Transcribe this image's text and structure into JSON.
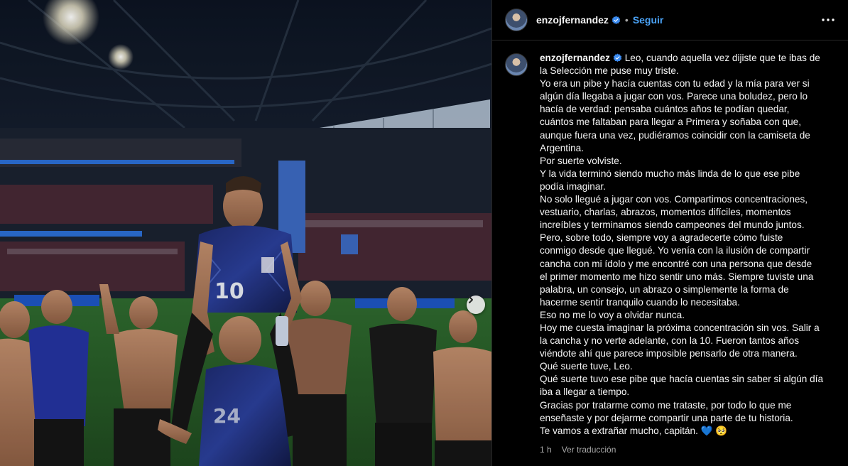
{
  "post": {
    "username": "enzojfernandez",
    "follow_label": "Seguir",
    "separator": "•",
    "time_ago": "1 h",
    "translate_label": "Ver traducción"
  },
  "photo": {
    "jersey_number": "10",
    "jersey_number_2": "24"
  },
  "caption_lines": [
    "Leo, cuando aquella vez dijiste que te ibas de",
    "la Selección me puse muy triste.",
    "Yo era un pibe y hacía cuentas con tu edad y la mía para ver si",
    "algún día llegaba a jugar con vos. Parece una boludez, pero lo",
    "hacía de verdad: pensaba cuántos años te podían quedar,",
    "cuántos me faltaban para llegar a Primera y soñaba con que,",
    "aunque fuera una vez, pudiéramos coincidir con la camiseta de",
    "Argentina.",
    "Por suerte volviste.",
    "Y la vida terminó siendo mucho más linda de lo que ese pibe",
    "podía imaginar.",
    "No solo llegué a jugar con vos. Compartimos concentraciones,",
    "vestuario, charlas, abrazos, momentos difíciles, momentos",
    "increíbles y terminamos siendo campeones del mundo juntos.",
    "Pero, sobre todo, siempre voy a agradecerte cómo fuiste",
    "conmigo desde que llegué. Yo venía con la ilusión de compartir",
    "cancha con mi ídolo y me encontré con una persona que desde",
    "el primer momento me hizo sentir uno más. Siempre tuviste una",
    "palabra, un consejo, un abrazo o simplemente la forma de",
    "hacerme sentir tranquilo cuando lo necesitaba.",
    "Eso no me lo voy a olvidar nunca.",
    "Hoy me cuesta imaginar la próxima concentración sin vos. Salir a",
    "la cancha y no verte adelante, con la 10. Fueron tantos años",
    "viéndote ahí que parece imposible pensarlo de otra manera.",
    "Qué suerte tuve, Leo.",
    "Qué suerte tuvo ese pibe que hacía cuentas sin saber si algún día",
    "iba a llegar a tiempo.",
    "Gracias por tratarme como me trataste, por todo lo que me",
    "enseñaste y por dejarme compartir una parte de tu historia.",
    "Te vamos a extrañar mucho, capitán. 💙 🥺"
  ],
  "colors": {
    "accent": "#4aa2f5",
    "verified": "#3b8bf0",
    "muted": "#a8a8a8"
  },
  "icons": [
    "verified-badge-icon",
    "more-options-icon",
    "chevron-right-icon"
  ]
}
